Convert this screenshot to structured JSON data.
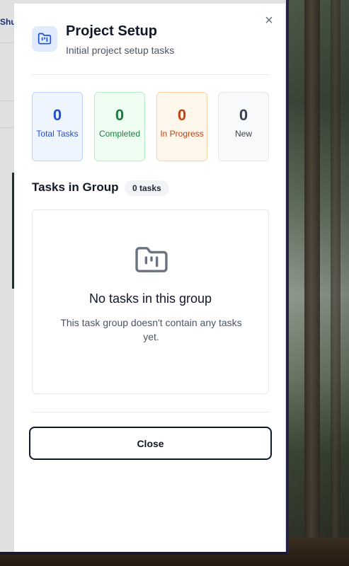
{
  "background": {
    "tab_fragment": "Shu"
  },
  "dialog": {
    "title": "Project Setup",
    "subtitle": "Initial project setup tasks",
    "close_icon": "×",
    "header_icon": "folder-kanban-icon"
  },
  "stats": [
    {
      "value": "0",
      "label": "Total Tasks",
      "color": "#1d4ed8"
    },
    {
      "value": "0",
      "label": "Completed",
      "color": "#15803d"
    },
    {
      "value": "0",
      "label": "In Progress",
      "color": "#c2410c"
    },
    {
      "value": "0",
      "label": "New",
      "color": "#374151"
    }
  ],
  "section": {
    "title": "Tasks in Group",
    "badge": "0 tasks"
  },
  "empty_state": {
    "icon": "folder-kanban-icon",
    "title": "No tasks in this group",
    "text": "This task group doesn't contain any tasks yet."
  },
  "footer": {
    "close_label": "Close"
  },
  "colors": {
    "accent_blue": "#1d4ed8",
    "icon_bg": "#e0ecfd"
  }
}
